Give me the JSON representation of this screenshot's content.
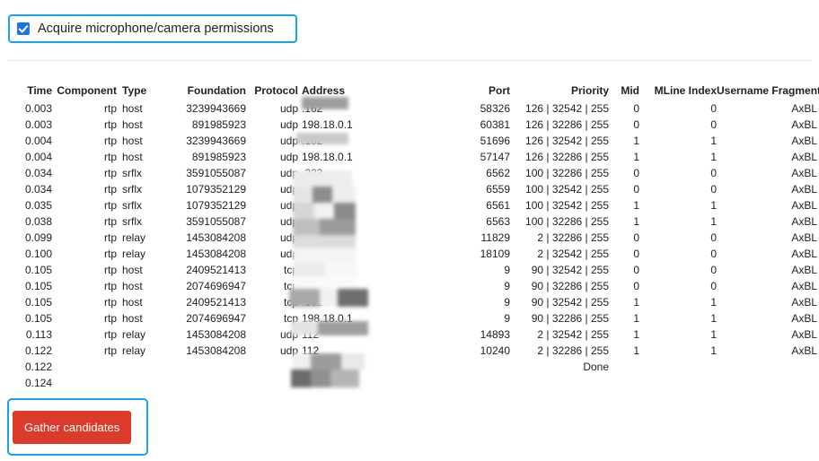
{
  "permission": {
    "label": "Acquire microphone/camera permissions",
    "checked": true,
    "checkbox_color": "#1a73e8",
    "focus_ring_color": "#1ba1f2"
  },
  "table": {
    "columns": [
      "Time",
      "Component",
      "Type",
      "Foundation",
      "Protocol",
      "Address",
      "Port",
      "Priority",
      "Mid",
      "MLine Index",
      "Username Fragment"
    ],
    "rows": [
      {
        "time": "0.003",
        "component": "rtp",
        "type": "host",
        "foundation": "3239943669",
        "protocol": "udp",
        "address": ".162",
        "address_redacted": true,
        "port": "58326",
        "priority": "126 | 32542 | 255",
        "mid": "0",
        "mline": "0",
        "ufrag": "AxBL"
      },
      {
        "time": "0.003",
        "component": "rtp",
        "type": "host",
        "foundation": "891985923",
        "protocol": "udp",
        "address": "198.18.0.1",
        "address_redacted": false,
        "port": "60381",
        "priority": "126 | 32286 | 255",
        "mid": "0",
        "mline": "0",
        "ufrag": "AxBL"
      },
      {
        "time": "0.004",
        "component": "rtp",
        "type": "host",
        "foundation": "3239943669",
        "protocol": "udp",
        "address": ".162",
        "address_redacted": true,
        "port": "51696",
        "priority": "126 | 32542 | 255",
        "mid": "1",
        "mline": "1",
        "ufrag": "AxBL"
      },
      {
        "time": "0.004",
        "component": "rtp",
        "type": "host",
        "foundation": "891985923",
        "protocol": "udp",
        "address": "198.18.0.1",
        "address_redacted": false,
        "port": "57147",
        "priority": "126 | 32286 | 255",
        "mid": "1",
        "mline": "1",
        "ufrag": "AxBL"
      },
      {
        "time": "0.034",
        "component": "rtp",
        "type": "srflx",
        "foundation": "3591055087",
        "protocol": "udp",
        "address": ".223",
        "address_redacted": true,
        "port": "6562",
        "priority": "100 | 32286 | 255",
        "mid": "0",
        "mline": "0",
        "ufrag": "AxBL"
      },
      {
        "time": "0.034",
        "component": "rtp",
        "type": "srflx",
        "foundation": "1079352129",
        "protocol": "udp",
        "address": ".223",
        "address_redacted": true,
        "port": "6559",
        "priority": "100 | 32542 | 255",
        "mid": "0",
        "mline": "0",
        "ufrag": "AxBL"
      },
      {
        "time": "0.035",
        "component": "rtp",
        "type": "srflx",
        "foundation": "1079352129",
        "protocol": "udp",
        "address": ".223",
        "address_redacted": true,
        "port": "6561",
        "priority": "100 | 32542 | 255",
        "mid": "1",
        "mline": "1",
        "ufrag": "AxBL"
      },
      {
        "time": "0.038",
        "component": "rtp",
        "type": "srflx",
        "foundation": "3591055087",
        "protocol": "udp",
        "address": ".223",
        "address_redacted": true,
        "port": "6563",
        "priority": "100 | 32286 | 255",
        "mid": "1",
        "mline": "1",
        "ufrag": "AxBL"
      },
      {
        "time": "0.099",
        "component": "rtp",
        "type": "relay",
        "foundation": "1453084208",
        "protocol": "udp",
        "address": ".112",
        "address_redacted": true,
        "port": "11829",
        "priority": "2 | 32286 | 255",
        "mid": "0",
        "mline": "0",
        "ufrag": "AxBL"
      },
      {
        "time": "0.100",
        "component": "rtp",
        "type": "relay",
        "foundation": "1453084208",
        "protocol": "udp",
        "address": ".112",
        "address_redacted": true,
        "port": "18109",
        "priority": "2 | 32542 | 255",
        "mid": "0",
        "mline": "0",
        "ufrag": "AxBL"
      },
      {
        "time": "0.105",
        "component": "rtp",
        "type": "host",
        "foundation": "2409521413",
        "protocol": "tcp",
        "address": ".162",
        "address_redacted": true,
        "port": "9",
        "priority": "90 | 32542 | 255",
        "mid": "0",
        "mline": "0",
        "ufrag": "AxBL"
      },
      {
        "time": "0.105",
        "component": "rtp",
        "type": "host",
        "foundation": "2074696947",
        "protocol": "tcp",
        "address": "198.18.0.1",
        "address_redacted": false,
        "port": "9",
        "priority": "90 | 32286 | 255",
        "mid": "0",
        "mline": "0",
        "ufrag": "AxBL"
      },
      {
        "time": "0.105",
        "component": "rtp",
        "type": "host",
        "foundation": "2409521413",
        "protocol": "tcp",
        "address": ".162",
        "address_redacted": true,
        "port": "9",
        "priority": "90 | 32542 | 255",
        "mid": "1",
        "mline": "1",
        "ufrag": "AxBL"
      },
      {
        "time": "0.105",
        "component": "rtp",
        "type": "host",
        "foundation": "2074696947",
        "protocol": "tcp",
        "address": "198.18.0.1",
        "address_redacted": false,
        "port": "9",
        "priority": "90 | 32286 | 255",
        "mid": "1",
        "mline": "1",
        "ufrag": "AxBL"
      },
      {
        "time": "0.113",
        "component": "rtp",
        "type": "relay",
        "foundation": "1453084208",
        "protocol": "udp",
        "address": "112",
        "address_redacted": true,
        "port": "14893",
        "priority": "2 | 32542 | 255",
        "mid": "1",
        "mline": "1",
        "ufrag": "AxBL"
      },
      {
        "time": "0.122",
        "component": "rtp",
        "type": "relay",
        "foundation": "1453084208",
        "protocol": "udp",
        "address": "112",
        "address_redacted": true,
        "port": "10240",
        "priority": "2 | 32286 | 255",
        "mid": "1",
        "mline": "1",
        "ufrag": "AxBL"
      },
      {
        "time": "0.122",
        "component": "",
        "type": "",
        "foundation": "",
        "protocol": "",
        "address": "",
        "address_redacted": false,
        "port": "",
        "priority": "Done",
        "mid": "",
        "mline": "",
        "ufrag": ""
      },
      {
        "time": "0.124",
        "component": "",
        "type": "",
        "foundation": "",
        "protocol": "",
        "address": "",
        "address_redacted": false,
        "port": "",
        "priority": "",
        "mid": "",
        "mline": "",
        "ufrag": ""
      }
    ]
  },
  "actions": {
    "gather_label": "Gather candidates",
    "gather_color": "#db3b2b",
    "focus_ring_color": "#1ba1f2"
  }
}
